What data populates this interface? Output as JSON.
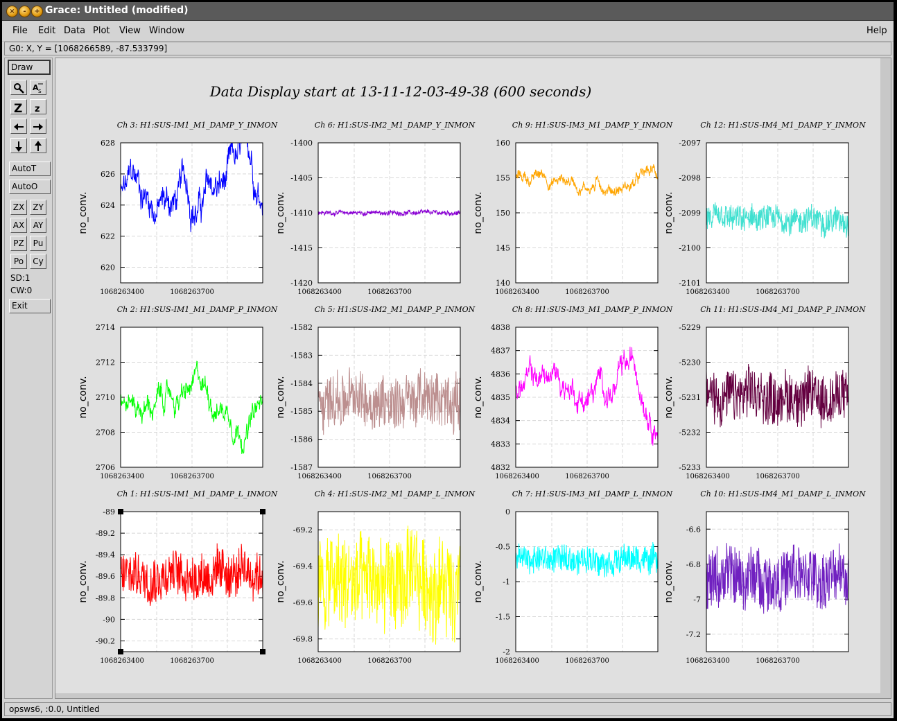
{
  "window": {
    "title": "Grace: Untitled (modified)"
  },
  "menu": {
    "file": "File",
    "edit": "Edit",
    "data": "Data",
    "plot": "Plot",
    "view": "View",
    "window": "Window",
    "help": "Help"
  },
  "locator": "G0: X, Y = [1068266589, -87.533799]",
  "status": "opsws6, :0.0, Untitled",
  "tools": {
    "draw": "Draw",
    "autot": "AutoT",
    "autoo": "AutoO",
    "zx": "ZX",
    "zy": "ZY",
    "ax": "AX",
    "ay": "AY",
    "pz": "PZ",
    "pu": "Pu",
    "po": "Po",
    "cy": "Cy",
    "sd": "SD:1",
    "cw": "CW:0",
    "exit": "Exit",
    "icons": [
      "magnify-icon",
      "autoscale-icon",
      "zoom-in-icon",
      "zoom-out-icon",
      "left-arrow-icon",
      "right-arrow-icon",
      "down-arrow-icon",
      "up-arrow-icon"
    ]
  },
  "canvas": {
    "main_title": "Data Display start at 13-11-12-03-49-38 (600 seconds)"
  },
  "chart_data": [
    {
      "type": "line",
      "title": "Ch 3: H1:SUS-IM1_M1_DAMP_Y_INMON",
      "ylabel": "no_conv.",
      "xticks": [
        "1068263400",
        "1068263700"
      ],
      "yticks": [
        "628",
        "626",
        "624",
        "622",
        "620"
      ],
      "ylim": [
        619,
        628
      ],
      "color": "#0000ff",
      "center": 624.5,
      "spread": 1.0,
      "style": "wander"
    },
    {
      "type": "line",
      "title": "Ch 6: H1:SUS-IM2_M1_DAMP_Y_INMON",
      "ylabel": "no_conv.",
      "xticks": [
        "1068263400",
        "1068263700"
      ],
      "yticks": [
        "-1400",
        "-1405",
        "-1410",
        "-1415",
        "-1420"
      ],
      "ylim": [
        -1420,
        -1400
      ],
      "color": "#8a00d4",
      "center": -1410,
      "spread": 0.5,
      "style": "flat"
    },
    {
      "type": "line",
      "title": "Ch 9: H1:SUS-IM3_M1_DAMP_Y_INMON",
      "ylabel": "no_conv.",
      "xticks": [
        "1068263400",
        "1068263700"
      ],
      "yticks": [
        "160",
        "155",
        "150",
        "145",
        "140"
      ],
      "ylim": [
        140,
        160
      ],
      "color": "#ffa500",
      "center": 155,
      "spread": 0.8,
      "style": "wander"
    },
    {
      "type": "line",
      "title": "Ch 12: H1:SUS-IM4_M1_DAMP_Y_INMON",
      "ylabel": "no_conv.",
      "xticks": [
        "1068263400",
        "1068263700"
      ],
      "yticks": [
        "-2097",
        "-2098",
        "-2099",
        "-2100",
        "-2101"
      ],
      "ylim": [
        -2101,
        -2097
      ],
      "color": "#40e0d0",
      "center": -2099.2,
      "spread": 0.35,
      "style": "noise"
    },
    {
      "type": "line",
      "title": "Ch 2: H1:SUS-IM1_M1_DAMP_P_INMON",
      "ylabel": "no_conv.",
      "xticks": [
        "1068263400",
        "1068263700"
      ],
      "yticks": [
        "2714",
        "2712",
        "2710",
        "2708",
        "2706"
      ],
      "ylim": [
        2706,
        2714
      ],
      "color": "#00ff00",
      "center": 2709.8,
      "spread": 0.6,
      "style": "wander"
    },
    {
      "type": "line",
      "title": "Ch 5: H1:SUS-IM2_M1_DAMP_P_INMON",
      "ylabel": "no_conv.",
      "xticks": [
        "1068263400",
        "1068263700"
      ],
      "yticks": [
        "-1582",
        "-1583",
        "-1584",
        "-1585",
        "-1586",
        "-1587"
      ],
      "ylim": [
        -1587,
        -1582
      ],
      "color": "#bc8f8f",
      "center": -1584.6,
      "spread": 0.9,
      "style": "noise"
    },
    {
      "type": "line",
      "title": "Ch 8: H1:SUS-IM3_M1_DAMP_P_INMON",
      "ylabel": "no_conv.",
      "xticks": [
        "1068263400",
        "1068263700"
      ],
      "yticks": [
        "4838",
        "4837",
        "4836",
        "4835",
        "4834",
        "4833",
        "4832"
      ],
      "ylim": [
        4832,
        4838
      ],
      "color": "#ff00ff",
      "center": 4835.5,
      "spread": 0.5,
      "style": "wander"
    },
    {
      "type": "line",
      "title": "Ch 11: H1:SUS-IM4_M1_DAMP_P_INMON",
      "ylabel": "no_conv.",
      "xticks": [
        "1068263400",
        "1068263700"
      ],
      "yticks": [
        "-5229",
        "-5230",
        "-5231",
        "-5232",
        "-5233"
      ],
      "ylim": [
        -5233,
        -5229
      ],
      "color": "#640040",
      "center": -5231,
      "spread": 0.7,
      "style": "noise"
    },
    {
      "type": "line",
      "title": "Ch 1: H1:SUS-IM1_M1_DAMP_L_INMON",
      "ylabel": "no_conv.",
      "xticks": [
        "1068263400",
        "1068263700"
      ],
      "yticks": [
        "-89",
        "-89.2",
        "-89.4",
        "-89.6",
        "-89.8",
        "-90",
        "-90.2"
      ],
      "ylim": [
        -90.3,
        -89
      ],
      "color": "#ff0000",
      "center": -89.58,
      "spread": 0.2,
      "style": "noise",
      "selected": true
    },
    {
      "type": "line",
      "title": "Ch 4: H1:SUS-IM2_M1_DAMP_L_INMON",
      "ylabel": "no_conv.",
      "xticks": [
        "1068263400",
        "1068263700"
      ],
      "yticks": [
        "-69.2",
        "-69.4",
        "-69.6",
        "-69.8"
      ],
      "ylim": [
        -69.87,
        -69.1
      ],
      "color": "#ffff00",
      "center": -69.5,
      "spread": 0.25,
      "style": "noise"
    },
    {
      "type": "line",
      "title": "Ch 7: H1:SUS-IM3_M1_DAMP_L_INMON",
      "ylabel": "no_conv.",
      "xticks": [
        "1068263400",
        "1068263700"
      ],
      "yticks": [
        "0",
        "-0.5",
        "-1",
        "-1.5",
        "-2"
      ],
      "ylim": [
        -2,
        0
      ],
      "color": "#00ffff",
      "center": -0.68,
      "spread": 0.18,
      "style": "noise"
    },
    {
      "type": "line",
      "title": "Ch 10: H1:SUS-IM4_M1_DAMP_L_INMON",
      "ylabel": "no_conv.",
      "xticks": [
        "1068263400",
        "1068263700"
      ],
      "yticks": [
        "-6.6",
        "-6.8",
        "-7",
        "-7.2"
      ],
      "ylim": [
        -7.3,
        -6.5
      ],
      "color": "#7020c0",
      "center": -6.88,
      "spread": 0.16,
      "style": "noise"
    }
  ]
}
